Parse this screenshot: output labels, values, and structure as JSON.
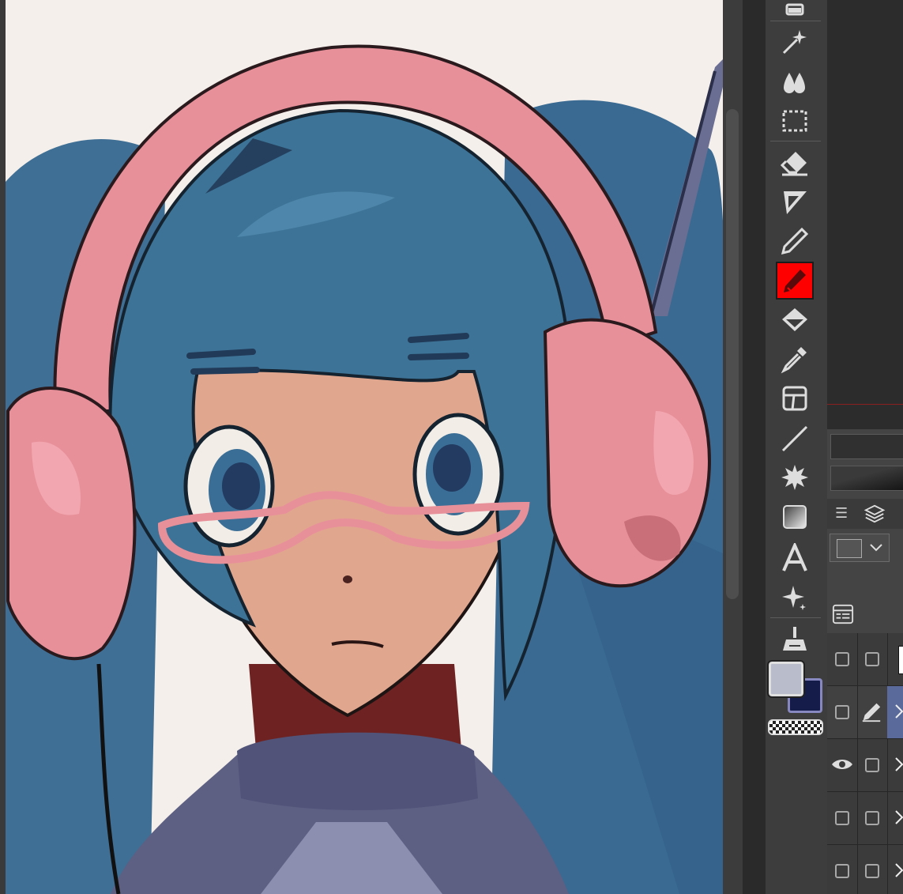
{
  "app": {
    "active_tool": "pen-tool"
  },
  "toolbar": {
    "tools": [
      "selection-partial",
      "auto-select",
      "blend",
      "rect-select",
      "eraser",
      "lasso-fill",
      "pencil",
      "pen",
      "fill",
      "eyedropper",
      "frame",
      "line",
      "decoration-burst",
      "gradient",
      "text",
      "sparkle",
      "cleanup"
    ]
  },
  "colors": {
    "main": "#b8bccb",
    "sub": "#161c4a",
    "accent_tool_bg": "#ff0000",
    "layer_selected": "#5a6a9a"
  },
  "layers": {
    "rows": [
      {
        "visible": false,
        "locked": false
      },
      {
        "visible": false,
        "editing": true,
        "selected": true
      },
      {
        "visible": true,
        "locked": false
      },
      {
        "visible": false,
        "locked": false
      },
      {
        "visible": false,
        "locked": false
      }
    ]
  }
}
